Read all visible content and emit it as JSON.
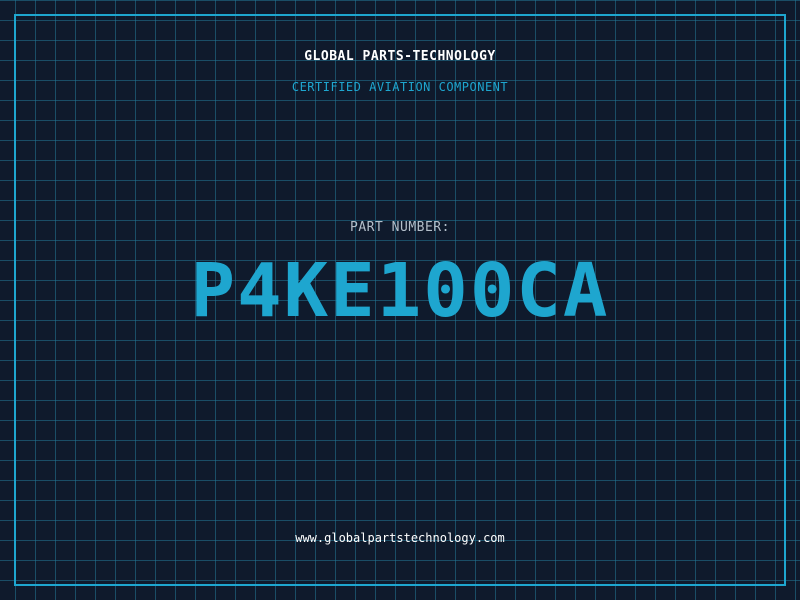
{
  "header": {
    "company": "GLOBAL PARTS-TECHNOLOGY",
    "subtitle": "CERTIFIED AVIATION COMPONENT"
  },
  "part": {
    "label": "PART NUMBER:",
    "number": "P4KE100CA"
  },
  "footer": {
    "website": "www.globalpartstechnology.com"
  },
  "colors": {
    "background": "#0f1a2c",
    "grid": "#227696",
    "accent": "#1ea6cf",
    "label": "#b4bfca",
    "text": "#ffffff"
  }
}
